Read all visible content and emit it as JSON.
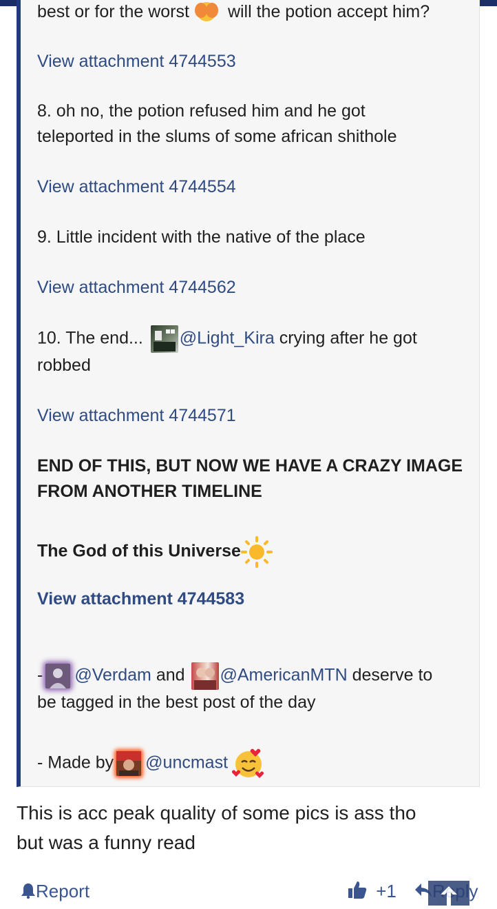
{
  "quote": {
    "line_top": "best or for the worst",
    "line_top_after": "will the potion accept him?",
    "attachments": [
      "View attachment 4744553",
      "View attachment 4744554",
      "View attachment 4744562",
      "View attachment 4744571",
      "View attachment 4744583"
    ],
    "item8_line1": "8. oh no, the potion refused him and he got",
    "item8_line2": "teleported in the slums of some african shithole",
    "item9": "9. Little incident with the native of the place",
    "item10_prefix": "10. The end...",
    "item10_mention": "@Light_Kira",
    "item10_suffix": "crying after he got",
    "item10_line2": "robbed",
    "end_line1": "END OF THIS, BUT NOW WE HAVE A CRAZY IMAGE",
    "end_line2": "FROM ANOTHER TIMELINE",
    "god_line": "The God of this Universe",
    "tag_prefix": "-",
    "tag_mention1": "@Verdam",
    "tag_and": "and",
    "tag_mention2": "@AmericanMTN",
    "tag_suffix": "deserve to",
    "tag_line2": "be tagged in the best post of the day",
    "made_by": "- Made by",
    "made_by_mention": "@uncmast"
  },
  "reply": {
    "line1": "This is acc peak quality of some pics is ass tho",
    "line2": "but was a funny read"
  },
  "footer": {
    "report": "Report",
    "like_count": "+1",
    "reply": "Reply"
  },
  "icons": {
    "bell": "bell-icon",
    "thumbs_up": "thumbs-up-icon",
    "reply_arrow": "reply-arrow-icon",
    "scroll_top": "arrow-up-icon"
  },
  "colors": {
    "header": "#1b2f66",
    "quote_border": "#233a78",
    "link": "#2f4b82",
    "footer_link": "#3a5590"
  }
}
